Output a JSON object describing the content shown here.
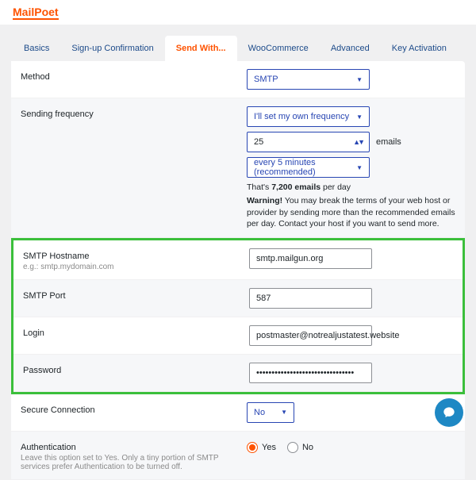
{
  "brand": {
    "name": "MailPoet"
  },
  "tabs": {
    "basics": "Basics",
    "signup": "Sign-up Confirmation",
    "sendwith": "Send With...",
    "woocommerce": "WooCommerce",
    "advanced": "Advanced",
    "keyactivation": "Key Activation"
  },
  "method": {
    "label": "Method",
    "value": "SMTP"
  },
  "frequency": {
    "label": "Sending frequency",
    "mode": "I'll set my own frequency",
    "count": "25",
    "count_suffix": "emails",
    "interval": "every 5 minutes (recommended)",
    "note_prefix": "That's ",
    "note_value": "7,200 emails",
    "note_suffix": " per day",
    "warning_label": "Warning!",
    "warning_text": " You may break the terms of your web host or provider by sending more than the recommended emails per day. Contact your host if you want to send more."
  },
  "smtp": {
    "hostname_label": "SMTP Hostname",
    "hostname_hint": "e.g.: smtp.mydomain.com",
    "hostname_value": "smtp.mailgun.org",
    "port_label": "SMTP Port",
    "port_value": "587",
    "login_label": "Login",
    "login_value": "postmaster@notrealjustatest.website",
    "password_label": "Password",
    "password_value": "••••••••••••••••••••••••••••••••"
  },
  "secure": {
    "label": "Secure Connection",
    "value": "No"
  },
  "auth": {
    "label": "Authentication",
    "hint": "Leave this option set to Yes. Only a tiny portion of SMTP services prefer Authentication to be turned off.",
    "yes": "Yes",
    "no": "No",
    "selected": "yes"
  }
}
